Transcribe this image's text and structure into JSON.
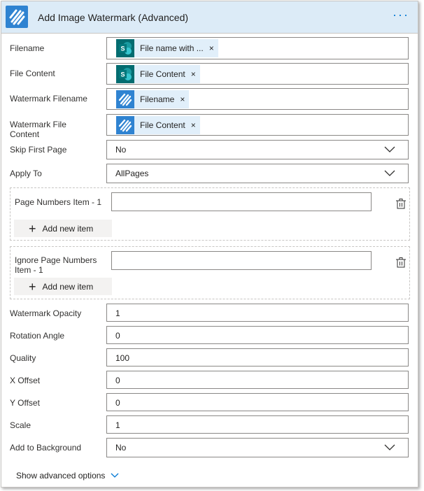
{
  "header": {
    "title": "Add Image Watermark (Advanced)",
    "menu_glyph": "···"
  },
  "fields": {
    "filename": {
      "label": "Filename",
      "token": "File name with ...",
      "token_source": "sharepoint-icon"
    },
    "file_content": {
      "label": "File Content",
      "token": "File Content",
      "token_source": "sharepoint-icon"
    },
    "watermark_filename": {
      "label": "Watermark Filename",
      "token": "Filename",
      "token_source": "encodian-icon"
    },
    "watermark_file_content": {
      "label_line1": "Watermark File",
      "label_line2": "Content",
      "token": "File Content",
      "token_source": "encodian-icon"
    },
    "skip_first_page": {
      "label": "Skip First Page",
      "value": "No"
    },
    "apply_to": {
      "label": "Apply To",
      "value": "AllPages"
    },
    "watermark_opacity": {
      "label": "Watermark Opacity",
      "value": "1"
    },
    "rotation_angle": {
      "label": "Rotation Angle",
      "value": "0"
    },
    "quality": {
      "label": "Quality",
      "value": "100"
    },
    "x_offset": {
      "label": "X Offset",
      "value": "0"
    },
    "y_offset": {
      "label": "Y Offset",
      "value": "0"
    },
    "scale": {
      "label": "Scale",
      "value": "1"
    },
    "add_to_background": {
      "label": "Add to Background",
      "value": "No"
    }
  },
  "arrays": {
    "page_numbers": {
      "label": "Page Numbers Item - 1",
      "value": "",
      "add_label": "Add new item"
    },
    "ignore_page_numbers": {
      "label_line1": "Ignore Page Numbers",
      "label_line2": "Item - 1",
      "value": "",
      "add_label": "Add new item"
    }
  },
  "footer": {
    "show_advanced": "Show advanced options"
  },
  "token_remove_glyph": "×",
  "plus_glyph": "+",
  "colors": {
    "accent": "#0078d4",
    "header_bg": "#dcebf7",
    "token_bg": "#e1effa",
    "sharepoint": "#036c70",
    "encodian": "#2f83d1"
  }
}
